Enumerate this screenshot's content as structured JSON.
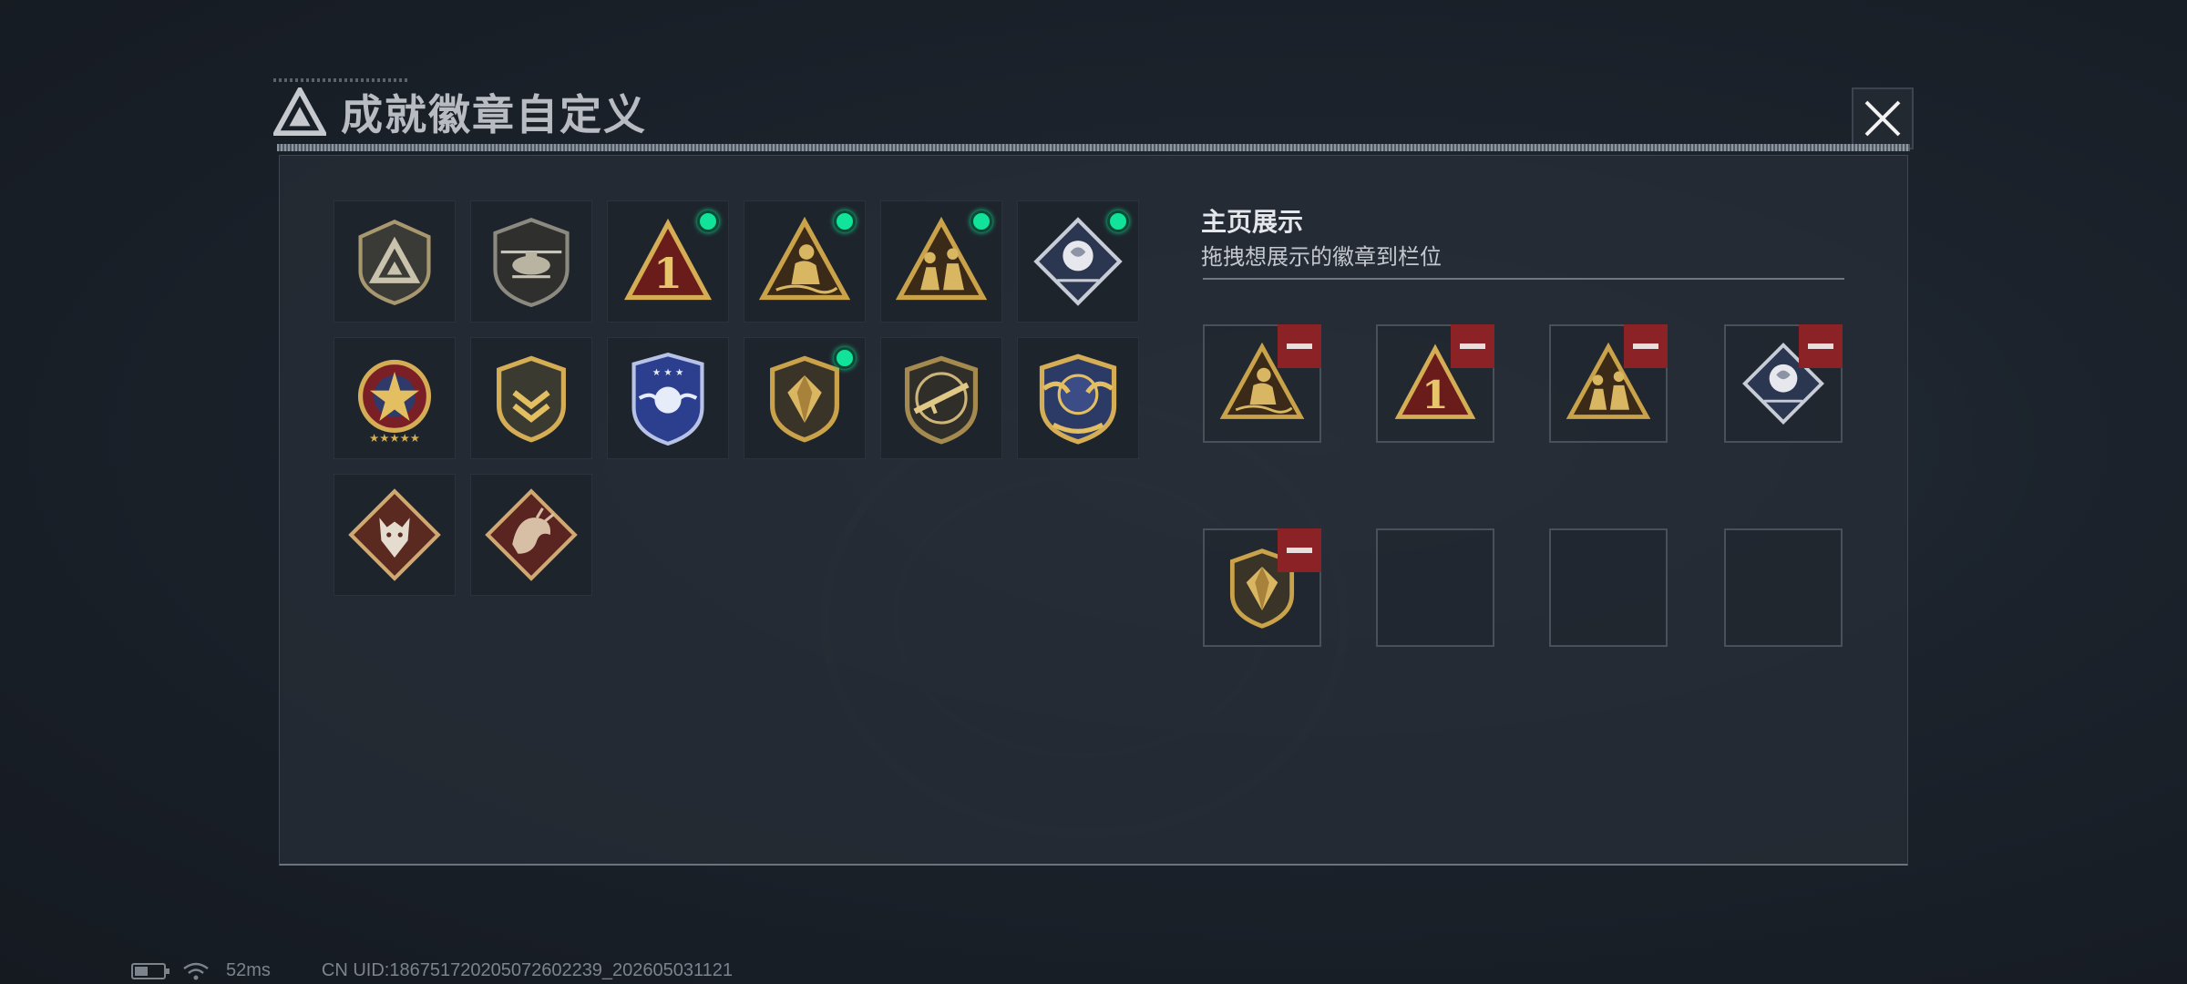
{
  "window": {
    "title": "成就徽章自定义",
    "close_icon": "close-icon"
  },
  "badges": [
    {
      "name": "triangle-logo-badge",
      "icon": "triangle-logo",
      "selected": false
    },
    {
      "name": "helicopter-badge",
      "icon": "helicopter",
      "selected": false
    },
    {
      "name": "number-one-badge",
      "icon": "number-one",
      "selected": true
    },
    {
      "name": "crouching-soldier-badge",
      "icon": "crouching-soldier",
      "selected": true
    },
    {
      "name": "squad-badge",
      "icon": "squad",
      "selected": true
    },
    {
      "name": "rose-badge",
      "icon": "rose",
      "selected": true
    },
    {
      "name": "star-medal-badge",
      "icon": "star-medal",
      "selected": false
    },
    {
      "name": "chevron-shield-badge",
      "icon": "chevron-shield",
      "selected": false
    },
    {
      "name": "blue-wings-badge",
      "icon": "blue-wings",
      "selected": false
    },
    {
      "name": "gem-shield-badge",
      "icon": "gem-shield",
      "selected": true
    },
    {
      "name": "rifle-badge",
      "icon": "rifle",
      "selected": false
    },
    {
      "name": "winged-globe-badge",
      "icon": "winged-globe",
      "selected": false
    },
    {
      "name": "wolf-badge",
      "icon": "wolf",
      "selected": false
    },
    {
      "name": "dragon-badge",
      "icon": "dragon",
      "selected": false
    }
  ],
  "showcase": {
    "title": "主页展示",
    "subtitle": "拖拽想展示的徽章到栏位",
    "slots": [
      {
        "badge": "crouching-soldier",
        "filled": true
      },
      {
        "badge": "number-one",
        "filled": true
      },
      {
        "badge": "squad",
        "filled": true
      },
      {
        "badge": "rose",
        "filled": true
      },
      {
        "badge": "gem-shield",
        "filled": true
      },
      {
        "badge": "",
        "filled": false
      },
      {
        "badge": "",
        "filled": false
      },
      {
        "badge": "",
        "filled": false
      }
    ]
  },
  "status": {
    "ping": "52ms",
    "uid": "CN UID:18675172020507260223​9_202605031121",
    "battery_icon": "battery-icon",
    "wifi_icon": "wifi-icon"
  },
  "colors": {
    "accent_green": "#12e39a",
    "remove_red": "#8b2326",
    "gold": "#c9a24a"
  }
}
